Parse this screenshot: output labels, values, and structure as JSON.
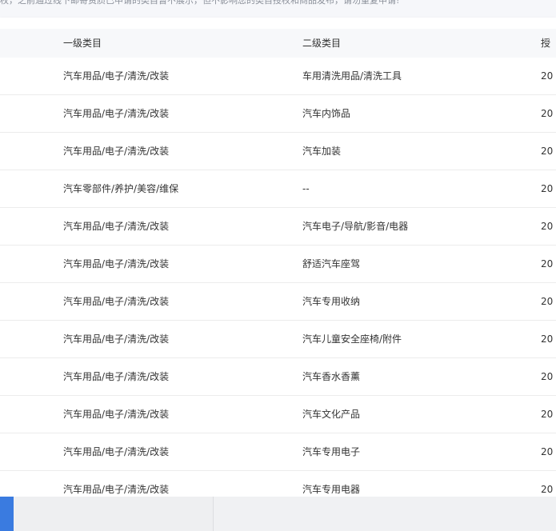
{
  "notice": {
    "text": "权，之前通过线下邮寄资质已申请的类目暂不展示，但不影响您的类目授权和商品发布，请勿重复申请!"
  },
  "table": {
    "headers": {
      "primary": "一级类目",
      "secondary": "二级类目",
      "third": "授"
    },
    "rows": [
      {
        "primary": "汽车用品/电子/清洗/改装",
        "secondary": "车用清洗用品/清洗工具",
        "date": "20"
      },
      {
        "primary": "汽车用品/电子/清洗/改装",
        "secondary": "汽车内饰品",
        "date": "20"
      },
      {
        "primary": "汽车用品/电子/清洗/改装",
        "secondary": "汽车加装",
        "date": "20"
      },
      {
        "primary": "汽车零部件/养护/美容/维保",
        "secondary": "--",
        "date": "20"
      },
      {
        "primary": "汽车用品/电子/清洗/改装",
        "secondary": "汽车电子/导航/影音/电器",
        "date": "20"
      },
      {
        "primary": "汽车用品/电子/清洗/改装",
        "secondary": "舒适汽车座驾",
        "date": "20"
      },
      {
        "primary": "汽车用品/电子/清洗/改装",
        "secondary": "汽车专用收纳",
        "date": "20"
      },
      {
        "primary": "汽车用品/电子/清洗/改装",
        "secondary": "汽车儿童安全座椅/附件",
        "date": "20"
      },
      {
        "primary": "汽车用品/电子/清洗/改装",
        "secondary": "汽车香水香薰",
        "date": "20"
      },
      {
        "primary": "汽车用品/电子/清洗/改装",
        "secondary": "汽车文化产品",
        "date": "20"
      },
      {
        "primary": "汽车用品/电子/清洗/改装",
        "secondary": "汽车专用电子",
        "date": "20"
      },
      {
        "primary": "汽车用品/电子/清洗/改装",
        "secondary": "汽车专用电器",
        "date": "20"
      }
    ]
  },
  "colors": {
    "accent_blue": "#3a7be0",
    "header_bg": "#f7f8fa",
    "row_border": "#ececec"
  }
}
